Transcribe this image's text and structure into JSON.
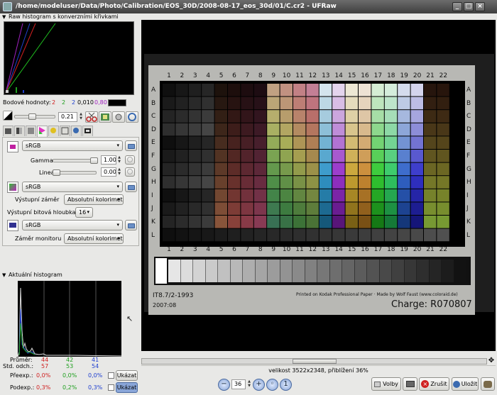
{
  "window": {
    "title": "/home/modeluser/Data/Photo/Calibration/EOS_30D/2008-08-17_eos_30d/01/C.cr2 - UFRaw",
    "buttons": [
      "_",
      "□",
      "×"
    ]
  },
  "raw_histogram": {
    "header": "Raw histogram s konverzními křivkami"
  },
  "point_values": {
    "label": "Bodové hodnoty:",
    "r": "2",
    "g": "2",
    "b": "2",
    "v1": "0,010",
    "v2": "0,80"
  },
  "exposure": {
    "value": "0.21"
  },
  "color_management": {
    "input_profile": "sRGB",
    "gamma_label": "Gamma",
    "gamma_value": "1.00",
    "linearity_label": "Linearita",
    "linearity_value": "0.00",
    "output_profile": "sRGB",
    "output_intent_label": "Výstupní záměr",
    "output_intent_value": "Absolutní kolorimet",
    "bit_depth_label": "Výstupní bitová hloubka",
    "bit_depth_value": "16",
    "monitor_profile": "sRGB",
    "monitor_intent_label": "Záměr monitoru",
    "monitor_intent_value": "Absolutní kolorimet"
  },
  "actual_histogram": {
    "header": "Aktuální histogram"
  },
  "stats": {
    "avg_label": "Průměr:",
    "avg": [
      "44",
      "42",
      "41"
    ],
    "std_label": "Std. odch.:",
    "std": [
      "57",
      "53",
      "54"
    ],
    "over_label": "Přeexp.:",
    "over": [
      "0,0%",
      "0,0%",
      "0,0%"
    ],
    "over_btn": "Ukázat",
    "under_label": "Podexp.:",
    "under": [
      "0,3%",
      "0,2%",
      "0,3%"
    ],
    "under_btn": "Ukázat"
  },
  "target": {
    "columns": [
      "1",
      "2",
      "3",
      "4",
      "5",
      "6",
      "7",
      "8",
      "9",
      "10",
      "11",
      "12",
      "13",
      "14",
      "15",
      "16",
      "17",
      "18",
      "19",
      "20",
      "21",
      "22"
    ],
    "rows": [
      "A",
      "B",
      "C",
      "D",
      "E",
      "F",
      "G",
      "H",
      "I",
      "J",
      "K",
      "L"
    ],
    "label1": "IT8.7/2-1993",
    "label2": "2007:08",
    "printed": "Printed on Kodak Professional Paper  ·  Made by Wolf Faust (www.coloraid.de)",
    "charge": "Charge: R070807"
  },
  "status": {
    "text": "velikost 3522x2348, přiblížení 36%"
  },
  "bottom": {
    "zoom": "36",
    "options": "Volby",
    "cancel": "Zrušit",
    "save": "Uložit"
  },
  "colors": {
    "red": "#d02020",
    "green": "#20a020",
    "blue": "#2040d0",
    "purple": "#a020c0"
  }
}
